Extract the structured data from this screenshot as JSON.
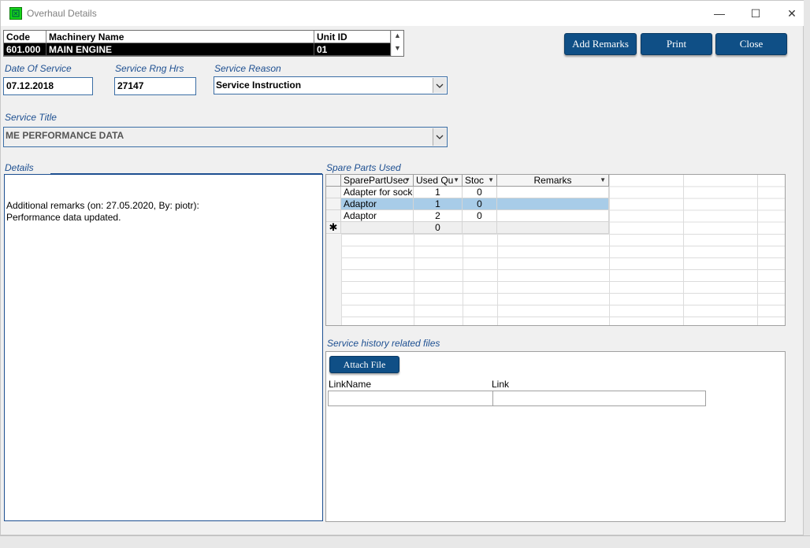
{
  "window": {
    "title": "Overhaul Details",
    "minimize_glyph": "—",
    "maximize_glyph": "☐",
    "close_glyph": "✕"
  },
  "machinery": {
    "headers": {
      "code": "Code",
      "name": "Machinery Name",
      "unit": "Unit ID"
    },
    "row": {
      "code": "601.000",
      "name": "MAIN ENGINE",
      "unit": "01"
    }
  },
  "buttons": {
    "add_remarks": "Add Remarks",
    "print": "Print",
    "close": "Close",
    "attach_file": "Attach File"
  },
  "form": {
    "date_of_service": {
      "label": "Date Of Service",
      "value": "07.12.2018"
    },
    "service_rng_hrs": {
      "label": "Service Rng Hrs",
      "value": "27147"
    },
    "service_reason": {
      "label": "Service Reason",
      "value": "Service Instruction"
    },
    "service_title": {
      "label": "Service Title",
      "value": "ME PERFORMANCE DATA"
    }
  },
  "details": {
    "label": "Details",
    "line1": "Additional remarks (on: 27.05.2020, By: piotr):",
    "line2": "Performance data updated."
  },
  "spare_parts": {
    "label": "Spare Parts Used",
    "columns": [
      "SparePartUsec",
      "Used Qu",
      "Stoc",
      "Remarks"
    ],
    "rows": [
      {
        "part": "Adapter for socket",
        "qty": "1",
        "stock": "0",
        "remarks": ""
      },
      {
        "part": "Adaptor",
        "qty": "1",
        "stock": "0",
        "remarks": ""
      },
      {
        "part": "Adaptor",
        "qty": "2",
        "stock": "0",
        "remarks": ""
      }
    ],
    "new_row": {
      "marker": "✱",
      "qty": "0"
    }
  },
  "files": {
    "label": "Service history related files",
    "columns": {
      "link_name": "LinkName",
      "link": "Link"
    }
  }
}
